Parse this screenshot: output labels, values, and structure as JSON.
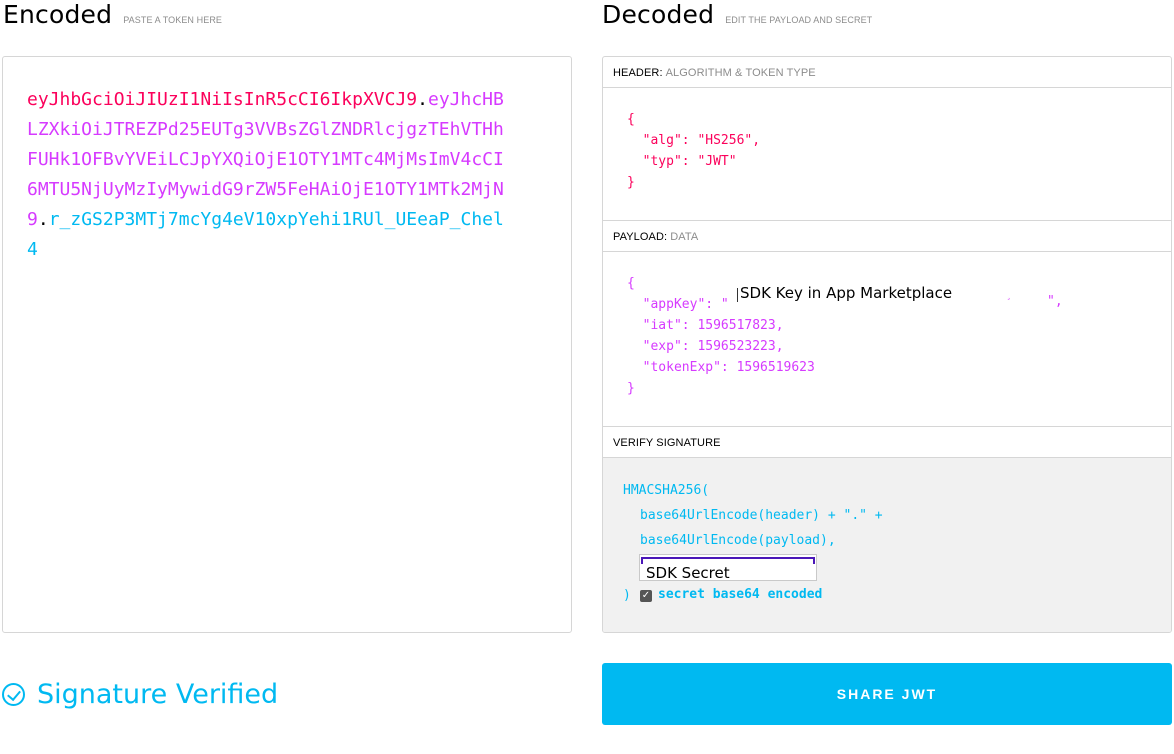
{
  "encoded": {
    "title": "Encoded",
    "subtitle": "PASTE A TOKEN HERE",
    "token": {
      "header": "eyJhbGciOiJIUzI1NiIsInR5cCI6IkpXVCJ9",
      "payload": "eyJhcHBLZXkiOiJTREZPd25EUTg3VVBsZGlZNDRlcjgzTEhVTHhFUHk1OFBvYVEiLCJpYXQiOjE1OTY1MTc4MjMsImV4cCI6MTU5NjUyMzIyMywidG9rZW5FeHAiOjE1OTY1MTk2MjN9",
      "signature": "r_zGS2P3MTj7mcYg4eV10xpYehi1RUl_UEeaP_Chel4",
      "separator": "."
    }
  },
  "decoded": {
    "title": "Decoded",
    "subtitle": "EDIT THE PAYLOAD AND SECRET",
    "header_section": {
      "label": "HEADER:",
      "sublabel": "ALGORITHM & TOKEN TYPE",
      "json": "{\n  \"alg\": \"HS256\",\n  \"typ\": \"JWT\"\n}"
    },
    "payload_section": {
      "label": "PAYLOAD:",
      "sublabel": "DATA",
      "line_open": "{",
      "line_appkey": "  \"appKey\": \"",
      "appkey_overlay_text": "SDK Key in App Marketplace",
      "appkey_overlay_mark": "¸",
      "appkey_close": "\",",
      "line_iat": "  \"iat\": 1596517823,",
      "line_exp": "  \"exp\": 1596523223,",
      "line_tokenexp": "  \"tokenExp\": 1596519623",
      "line_close": "}"
    },
    "verify_section": {
      "label": "VERIFY SIGNATURE",
      "line1": "HMACSHA256(",
      "line2": "base64UrlEncode(header) + \".\" +",
      "line3": "base64UrlEncode(payload),",
      "secret_value": "SDK Secret",
      "close": ")",
      "checkbox_checked": true,
      "checkbox_label": "secret base64 encoded"
    }
  },
  "status": {
    "text": "Signature Verified",
    "icon": "check-circle-icon"
  },
  "share_button_label": "SHARE JWT",
  "colors": {
    "header": "#fb015b",
    "payload": "#d63aff",
    "signature": "#00b9f1",
    "accent": "#00b9f1"
  }
}
